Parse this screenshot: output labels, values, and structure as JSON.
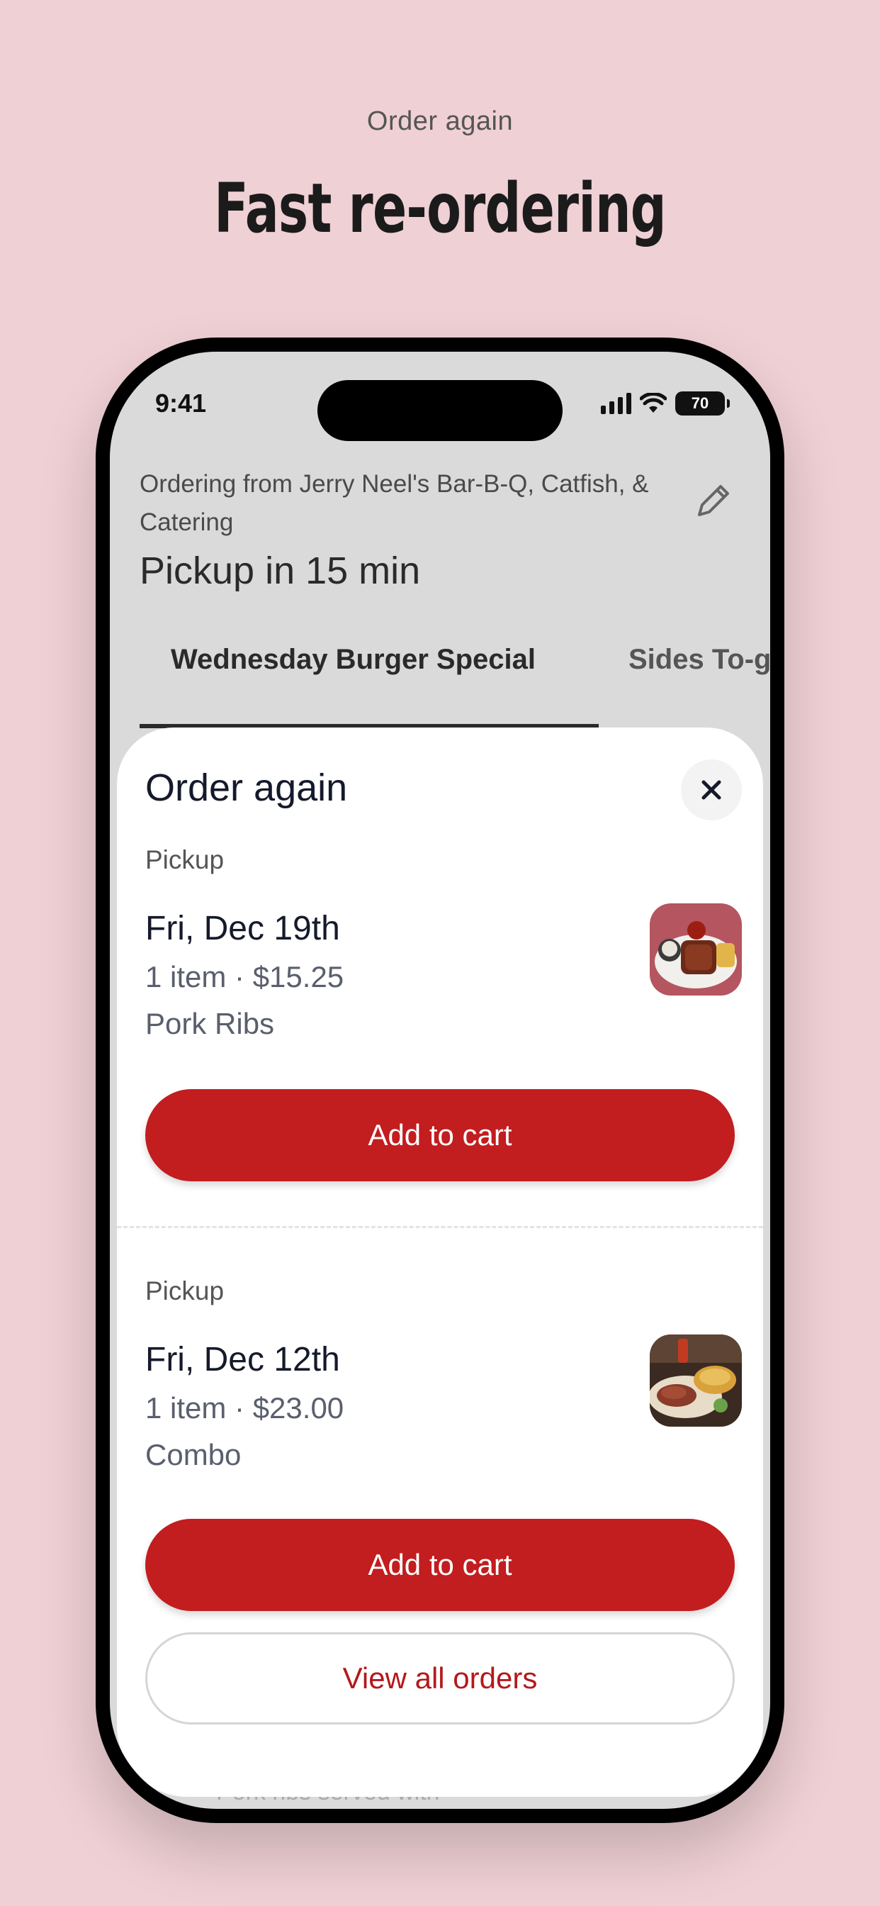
{
  "promo": {
    "eyebrow": "Order again",
    "headline": "Fast re-ordering"
  },
  "status_bar": {
    "time": "9:41",
    "battery": "70",
    "icons": [
      "signal-icon",
      "wifi-icon",
      "battery-icon"
    ]
  },
  "header": {
    "ordering_from": "Ordering from Jerry Neel's Bar-B-Q, Catfish, & Catering",
    "pickup_time": "Pickup in 15 min",
    "edit_icon": "pencil-icon"
  },
  "menu_tabs": [
    {
      "label": "Wednesday Burger Special",
      "active": true
    },
    {
      "label": "Sides To-go",
      "active": false
    }
  ],
  "behind_text": "Pork ribs served with",
  "sheet": {
    "title": "Order again",
    "close_icon": "close-icon",
    "orders": [
      {
        "type": "Pickup",
        "date": "Fri, Dec 19th",
        "summary": "1 item · $15.25",
        "item": "Pork Ribs",
        "button": "Add to cart",
        "thumbnail": "pork-ribs-photo"
      },
      {
        "type": "Pickup",
        "date": "Fri, Dec 12th",
        "summary": "1 item · $23.00",
        "item": "Combo",
        "button": "Add to cart",
        "thumbnail": "combo-platter-photo"
      }
    ],
    "view_all": "View all orders"
  },
  "colors": {
    "background": "#efd0d4",
    "brand_red": "#c21d1f",
    "link_red": "#b5181b"
  }
}
